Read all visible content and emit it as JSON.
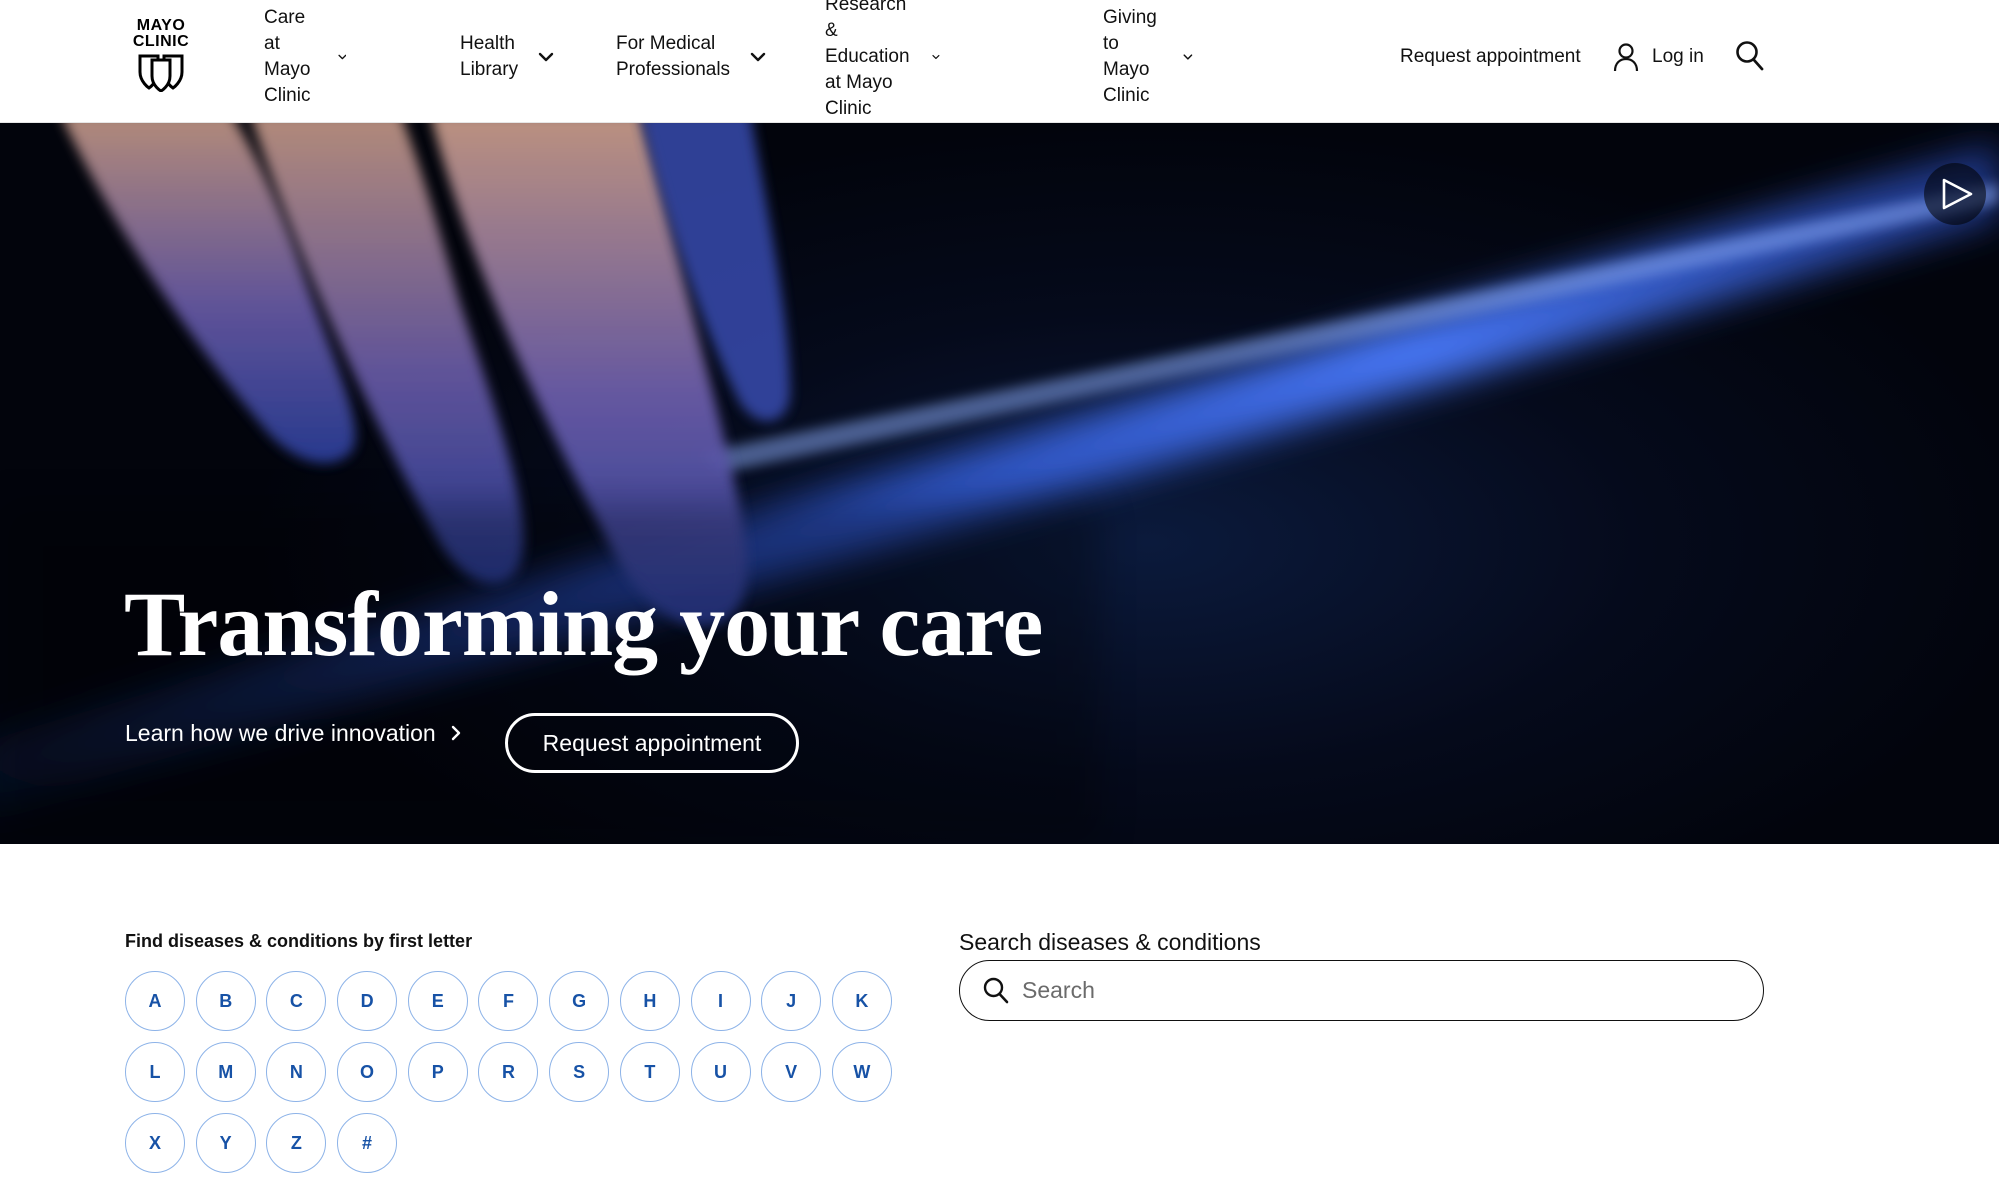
{
  "logo": {
    "line1": "MAYO",
    "line2": "CLINIC"
  },
  "nav": {
    "items": [
      {
        "line1": "Care at",
        "line2": "Mayo Clinic"
      },
      {
        "line1": "Health",
        "line2": "Library"
      },
      {
        "line1": "For Medical",
        "line2": "Professionals"
      },
      {
        "line1": "Research & Education",
        "line2": "at Mayo Clinic"
      },
      {
        "line1": "Giving to",
        "line2": "Mayo Clinic"
      }
    ],
    "request_appointment": "Request appointment",
    "login": "Log in"
  },
  "hero": {
    "title": "Transforming your care",
    "link_label": "Learn how we drive innovation",
    "button_label": "Request appointment"
  },
  "letters": {
    "heading": "Find diseases & conditions by first letter",
    "items": [
      "A",
      "B",
      "C",
      "D",
      "E",
      "F",
      "G",
      "H",
      "I",
      "J",
      "K",
      "L",
      "M",
      "N",
      "O",
      "P",
      "R",
      "S",
      "T",
      "U",
      "V",
      "W",
      "X",
      "Y",
      "Z",
      "#"
    ]
  },
  "search": {
    "label": "Search diseases & conditions",
    "placeholder": "Search"
  },
  "colors": {
    "letter_text": "#1752a6",
    "letter_border": "#8db3e8",
    "hero_background": "#050a1b",
    "hero_light": "#3f6dff"
  }
}
